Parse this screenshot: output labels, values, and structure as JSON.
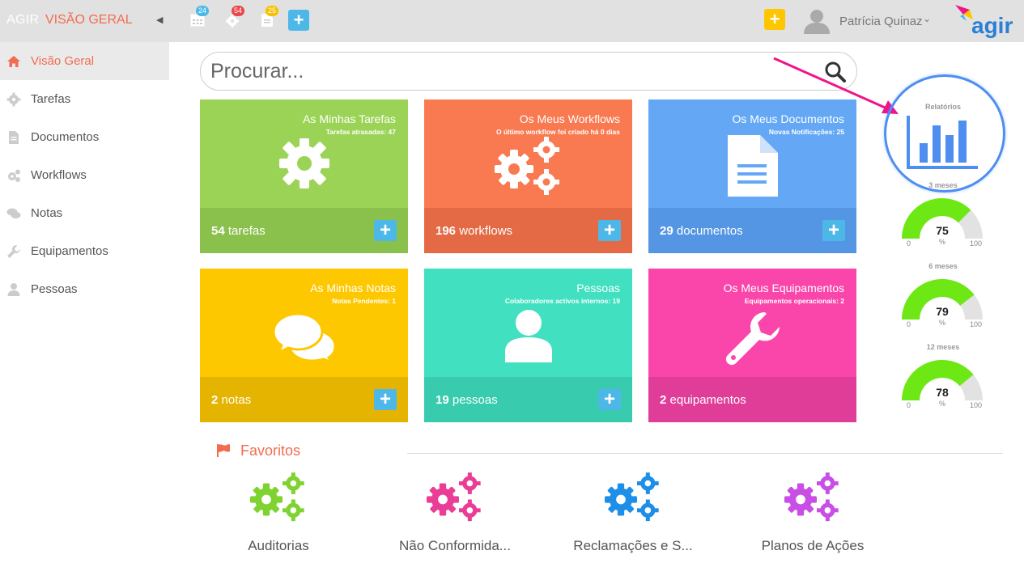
{
  "topbar": {
    "brand": "AGIR",
    "section": "VISÃO GERAL",
    "badges": {
      "calendar": "24",
      "gear": "54",
      "doc": "25"
    },
    "user_name": "Patrícia Quinaz",
    "logo_text": "agir"
  },
  "sidebar": {
    "items": [
      {
        "label": "Visão Geral",
        "icon": "home-icon"
      },
      {
        "label": "Tarefas",
        "icon": "gear-icon"
      },
      {
        "label": "Documentos",
        "icon": "document-icon"
      },
      {
        "label": "Workflows",
        "icon": "gears-icon"
      },
      {
        "label": "Notas",
        "icon": "chat-icon"
      },
      {
        "label": "Equipamentos",
        "icon": "wrench-icon"
      },
      {
        "label": "Pessoas",
        "icon": "person-icon"
      }
    ]
  },
  "search": {
    "placeholder": "Procurar..."
  },
  "tiles": [
    {
      "title": "As Minhas Tarefas",
      "subtitle": "Tarefas atrasadas: 47",
      "count": "54",
      "unit": "tarefas",
      "top": "#9bd356",
      "bottom": "#8ac04c"
    },
    {
      "title": "Os Meus Workflows",
      "subtitle": "O último workflow foi criado há 0 dias",
      "count": "196",
      "unit": "workflows",
      "top": "#f97a51",
      "bottom": "#e36a45"
    },
    {
      "title": "Os Meus Documentos",
      "subtitle": "Novas Notificações: 25",
      "count": "29",
      "unit": "documentos",
      "top": "#64a8f5",
      "bottom": "#5496e4"
    },
    {
      "title": "As Minhas Notas",
      "subtitle": "Notas Pendentes: 1",
      "count": "2",
      "unit": "notas",
      "top": "#fdc800",
      "bottom": "#e5b400"
    },
    {
      "title": "Pessoas",
      "subtitle": "Colaboradores activos internos: 19",
      "count": "19",
      "unit": "pessoas",
      "top": "#40e0c0",
      "bottom": "#38cbad"
    },
    {
      "title": "Os Meus Equipamentos",
      "subtitle": "Equipamentos operacionais: 2",
      "count": "2",
      "unit": "equipamentos",
      "top": "#fa46aa",
      "bottom": "#e03d98"
    }
  ],
  "reports": {
    "label": "Relatórios",
    "gauges": [
      {
        "label": "3 meses",
        "value": 75,
        "unit": "%",
        "min": "0",
        "max": "100"
      },
      {
        "label": "6 meses",
        "value": 79,
        "unit": "%",
        "min": "0",
        "max": "100"
      },
      {
        "label": "12 meses",
        "value": 78,
        "unit": "%",
        "min": "0",
        "max": "100"
      }
    ]
  },
  "favorites": {
    "title": "Favoritos",
    "items": [
      {
        "label": "Auditorias",
        "color": "#7ed331"
      },
      {
        "label": "Não Conformida...",
        "color": "#ea3d96"
      },
      {
        "label": "Reclamações e S...",
        "color": "#1e8fe8"
      },
      {
        "label": "Planos de Ações",
        "color": "#c94ee6"
      }
    ]
  },
  "colors": {
    "accent": "#f26c4f",
    "plus_blue": "#4db8e8",
    "plus_yellow": "#ffc600",
    "report_blue": "#4d8ef0",
    "arrow": "#f0148a"
  }
}
